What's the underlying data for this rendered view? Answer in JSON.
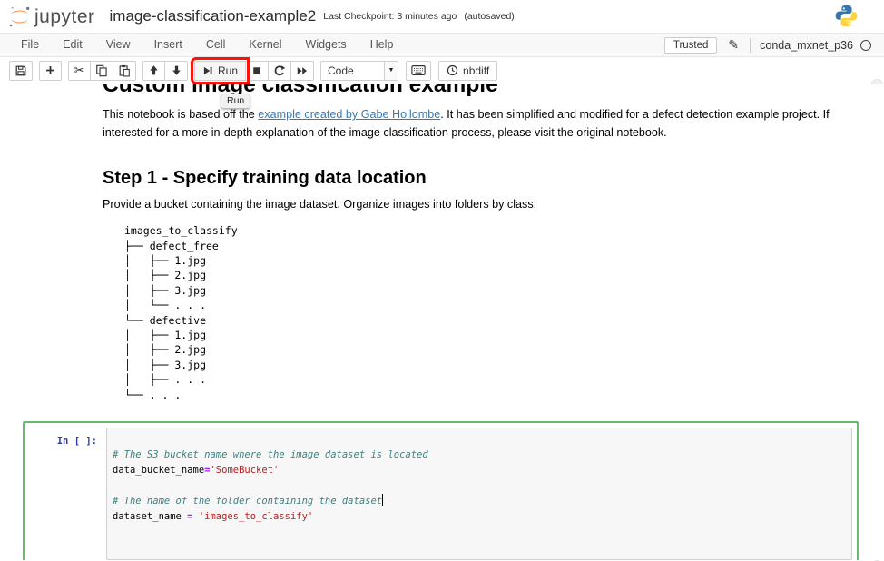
{
  "header": {
    "logo_text": "jupyter",
    "title": "image-classification-example2",
    "checkpoint": "Last Checkpoint: 3 minutes ago",
    "autosaved": "(autosaved)"
  },
  "menubar": {
    "items": [
      "File",
      "Edit",
      "View",
      "Insert",
      "Cell",
      "Kernel",
      "Widgets",
      "Help"
    ],
    "trusted_label": "Trusted",
    "kernel_name": "conda_mxnet_p36"
  },
  "toolbar": {
    "run_label": "Run",
    "cell_type_selected": "Code",
    "nbdiff_label": "nbdiff",
    "run_tooltip": "Run"
  },
  "notebook": {
    "h1": "Custom image classification example",
    "intro_before_link": "This notebook is based off the ",
    "intro_link": "example created by Gabe Hollombe",
    "intro_after_link": ". It has been simplified and modified for a defect detection example project. If interested for a more in-depth explanation of the image classification process, please visit the original notebook.",
    "h2": "Step 1 - Specify training data location",
    "step1_text": "Provide a bucket containing the image dataset. Organize images into folders by class.",
    "tree_lines": [
      "images_to_classify",
      "├── defect_free",
      "│   ├── 1.jpg",
      "│   ├── 2.jpg",
      "│   ├── 3.jpg",
      "│   └── . . .",
      "└── defective",
      "│   ├── 1.jpg",
      "│   ├── 2.jpg",
      "│   ├── 3.jpg",
      "│   ├── . . .",
      "└── . . ."
    ]
  },
  "cell": {
    "prompt": "In [ ]:",
    "comment1": "# The S3 bucket name where the image dataset is located",
    "var1": "data_bucket_name",
    "op1": "=",
    "str1": "'SomeBucket'",
    "comment2": "# The name of the folder containing the dataset",
    "var2": "dataset_name",
    "op2": " = ",
    "str2": "'images_to_classify'"
  },
  "colors": {
    "jupyter_orange": "#f37726",
    "edit_mode_green": "#66bb6a",
    "highlight_red": "#fb1208",
    "link_blue": "#337ab7",
    "prompt_blue": "#303f9f",
    "comment_teal": "#408080",
    "string_red": "#ba2121",
    "operator_purple": "#aa22ff"
  },
  "icons": {
    "jupyter-logo": "orange-planet-with-moons",
    "python-logo": "blue-yellow-snakes",
    "save-icon": "floppy-disk",
    "add-cell-icon": "plus",
    "cut-icon": "scissors",
    "copy-icon": "overlapping-pages",
    "paste-icon": "clipboard",
    "move-up-icon": "arrow-up",
    "move-down-icon": "arrow-down",
    "run-icon": "step-forward",
    "stop-icon": "square",
    "restart-icon": "refresh-arrow",
    "fast-forward-icon": "double-play",
    "dropdown-arrow-icon": "caret-down",
    "keyboard-icon": "keyboard",
    "nbdiff-icon": "clock",
    "edit-icon": "pencil",
    "kernel-status-icon": "circle-outline",
    "cut-glyph": "✂",
    "pencil-glyph": "✎",
    "caret-glyph": "▼"
  }
}
